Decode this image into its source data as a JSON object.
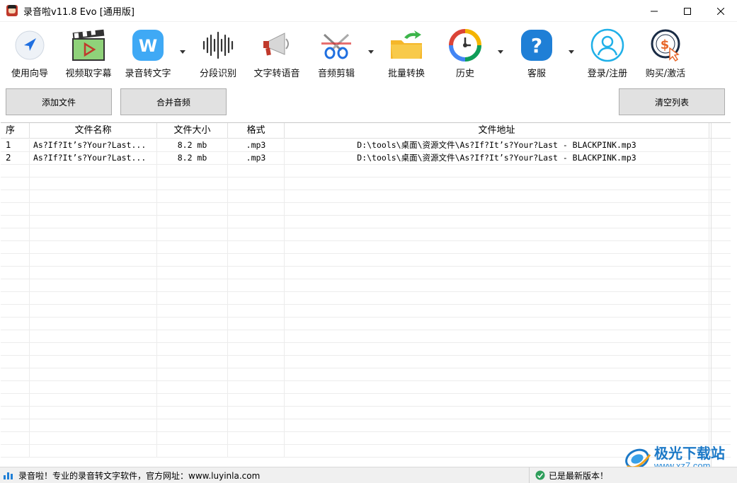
{
  "window": {
    "title": "录音啦v11.8 Evo [通用版]"
  },
  "toolbar": {
    "items": [
      {
        "label": "使用向导",
        "icon": "navigation-arrow-icon"
      },
      {
        "label": "视频取字幕",
        "icon": "video-clapper-icon"
      },
      {
        "label": "录音转文字",
        "icon": "w-logo-icon",
        "dropdown": true
      },
      {
        "label": "分段识别",
        "icon": "waveform-icon"
      },
      {
        "label": "文字转语音",
        "icon": "megaphone-icon"
      },
      {
        "label": "音频剪辑",
        "icon": "scissors-icon",
        "dropdown": true
      },
      {
        "label": "批量转换",
        "icon": "folder-arrow-icon"
      },
      {
        "label": "历史",
        "icon": "clock-history-icon",
        "dropdown": true
      },
      {
        "label": "客服",
        "icon": "question-icon",
        "dropdown": true
      },
      {
        "label": "登录/注册",
        "icon": "user-icon"
      },
      {
        "label": "购买/激活",
        "icon": "dollar-cursor-icon"
      }
    ]
  },
  "actions": {
    "add_file": "添加文件",
    "merge_audio": "合并音频",
    "clear_list": "清空列表"
  },
  "table": {
    "columns": [
      "序",
      "文件名称",
      "文件大小",
      "格式",
      "文件地址"
    ],
    "rows": [
      [
        "1",
        "As?If?It’s?Your?Last...",
        "8.2 mb",
        ".mp3",
        "D:\\tools\\桌面\\资源文件\\As?If?It’s?Your?Last - BLACKPINK.mp3"
      ],
      [
        "2",
        "As?If?It’s?Your?Last...",
        "8.2 mb",
        ".mp3",
        "D:\\tools\\桌面\\资源文件\\As?If?It’s?Your?Last - BLACKPINK.mp3"
      ]
    ]
  },
  "status": {
    "left_text": "录音啦！专业的录音转文字软件，官方网址：www.luyinla.com",
    "right_text": "已是最新版本！"
  },
  "watermark": {
    "title": "极光下载站",
    "url": "www.xz7.com"
  },
  "colors": {
    "accent_blue": "#1f8ce6",
    "button_bg": "#e1e1e1",
    "status_bg": "#f0f0f0"
  }
}
